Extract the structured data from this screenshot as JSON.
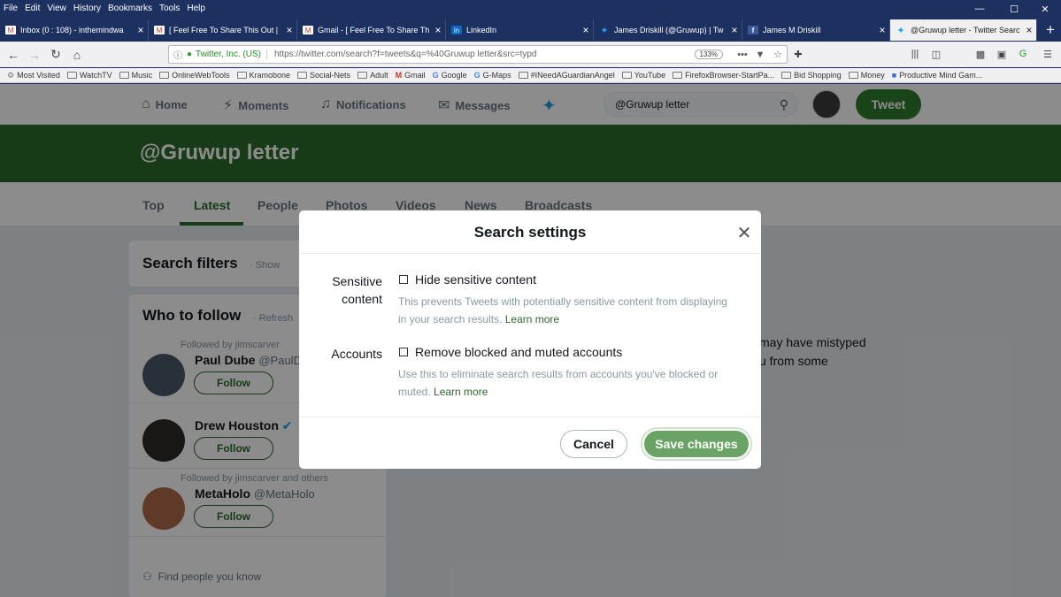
{
  "browser": {
    "menu": [
      "File",
      "Edit",
      "View",
      "History",
      "Bookmarks",
      "Tools",
      "Help"
    ],
    "tabs": [
      {
        "label": "Inbox (0 : 108) - inthemindwa",
        "icon": "gmail-icon"
      },
      {
        "label": "[ Feel Free To Share This Out |",
        "icon": "gmail-icon"
      },
      {
        "label": "Gmail - [ Feel Free To Share Th",
        "icon": "gmail-icon"
      },
      {
        "label": "LinkedIn",
        "icon": "linkedin-icon"
      },
      {
        "label": "James Driskill (@Gruwup) | Tw",
        "icon": "twitter-icon"
      },
      {
        "label": "James M Driskill",
        "icon": "facebook-icon"
      },
      {
        "label": "@Gruwup letter - Twitter Searc",
        "icon": "twitter-icon"
      }
    ],
    "url_site": "Twitter, Inc. (US)",
    "url": "https://twitter.com/search?f=tweets&q=%40Gruwup letter&src=typd",
    "zoom": "133%",
    "bookmarks": [
      "Most Visited",
      "WatchTV",
      "Music",
      "OnlineWebTools",
      "Kramobone",
      "Social-Nets",
      "Adult",
      "Gmail",
      "Google",
      "G-Maps",
      "#INeedAGuardianAngel",
      "YouTube",
      "FirefoxBrowser-StartPa...",
      "Bid Shopping",
      "Money",
      "Productive Mind Gam..."
    ]
  },
  "twitter": {
    "nav": {
      "home": "Home",
      "moments": "Moments",
      "notifications": "Notifications",
      "messages": "Messages"
    },
    "search_value": "@Gruwup letter",
    "tweet_button": "Tweet",
    "banner_title": "@Gruwup letter",
    "tabs": [
      "Top",
      "Latest",
      "People",
      "Photos",
      "Videos",
      "News",
      "Broadcasts"
    ],
    "active_tab": "Latest",
    "filters": {
      "title": "Search filters",
      "show": "· Show"
    },
    "who_to_follow": {
      "title": "Who to follow",
      "refresh": "· Refresh",
      "people": [
        {
          "context": "Followed by jimscarver",
          "name": "Paul Dube",
          "handle": "@PaulD",
          "follow": "Follow"
        },
        {
          "context": "",
          "name": "Drew Houston",
          "handle": "",
          "follow": "Follow"
        },
        {
          "context": "Followed by jimscarver and others",
          "name": "MetaHolo",
          "handle": "@MetaHolo",
          "follow": "Follow"
        }
      ],
      "find_people": "Find people you know"
    },
    "empty_line1": "may have mistyped",
    "empty_line2": "u from some"
  },
  "modal": {
    "title": "Search settings",
    "sensitive_label_1": "Sensitive",
    "sensitive_label_2": "content",
    "sensitive_checkbox": "Hide sensitive content",
    "sensitive_desc_1": "This prevents Tweets with potentially sensitive content from displaying",
    "sensitive_desc_2": "in your search results.",
    "sensitive_learn": "Learn more",
    "accounts_label": "Accounts",
    "accounts_checkbox": "Remove blocked and muted accounts",
    "accounts_desc_1": "Use this to eliminate search results from accounts you've blocked or",
    "accounts_desc_2": "muted.",
    "accounts_learn": "Learn more",
    "cancel": "Cancel",
    "save": "Save changes"
  },
  "colors": {
    "accent": "#2b6a2b",
    "save_button": "#6aa366",
    "chrome": "#1d3160"
  }
}
